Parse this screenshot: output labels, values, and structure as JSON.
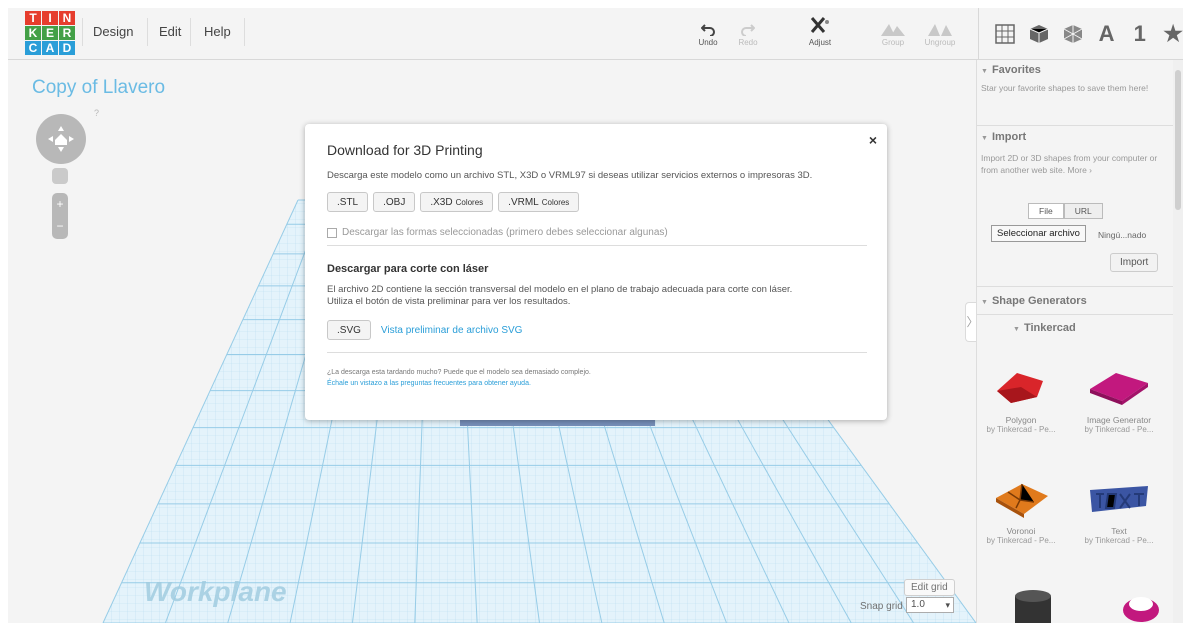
{
  "app": {
    "logo_letters": [
      "T",
      "I",
      "N",
      "K",
      "E",
      "R",
      "C",
      "A",
      "D"
    ],
    "menu": [
      "Design",
      "Edit",
      "Help"
    ],
    "toolbar": [
      {
        "label": "Undo",
        "icon": "undo-icon",
        "enabled": true
      },
      {
        "label": "Redo",
        "icon": "redo-icon",
        "enabled": false
      },
      {
        "label": "Adjust",
        "icon": "adjust-icon",
        "enabled": true
      },
      {
        "label": "Group",
        "icon": "group-icon",
        "enabled": false
      },
      {
        "label": "Ungroup",
        "icon": "ungroup-icon",
        "enabled": false
      }
    ],
    "view_tools": {
      "letter_a": "A",
      "number_1": "1",
      "star": "★"
    }
  },
  "workspace": {
    "project_title": "Copy of Llavero",
    "help_mark": "?",
    "workplane_label": "Workplane",
    "edit_grid": "Edit grid",
    "snap_grid_label": "Snap grid",
    "snap_grid_value": "1.0"
  },
  "dialog": {
    "title": "Download for 3D Printing",
    "close": "×",
    "description": "Descarga este modelo como un archivo STL, X3D o VRML97 si deseas utilizar servicios externos o impresoras 3D.",
    "formats": [
      {
        "label": ".STL",
        "sub": ""
      },
      {
        "label": ".OBJ",
        "sub": ""
      },
      {
        "label": ".X3D",
        "sub": "Colores"
      },
      {
        "label": ".VRML",
        "sub": "Colores"
      }
    ],
    "checkbox_label": "Descargar las formas seleccionadas (primero debes seleccionar algunas)",
    "laser_title": "Descargar para corte con láser",
    "laser_text_1": "El archivo 2D contiene la sección transversal del modelo en el plano de trabajo adecuada para corte con láser.",
    "laser_text_2": "Utiliza el botón de vista preliminar para ver los resultados.",
    "svg_button": ".SVG",
    "svg_preview_link": "Vista preliminar de archivo SVG",
    "note_1": "¿La descarga esta tardando mucho? Puede que el modelo sea demasiado complejo.",
    "note_2": "Échale un vistazo a las preguntas frecuentes para obtener ayuda."
  },
  "sidebar": {
    "favorites_title": "Favorites",
    "favorites_text": "Star your favorite shapes to save them here!",
    "import_title": "Import",
    "import_text": "Import 2D or 3D shapes from your computer or from another web site. More ›",
    "tab_file": "File",
    "tab_url": "URL",
    "select_file": "Seleccionar archivo",
    "file_status": "Ningú...nado",
    "import_button": "Import",
    "generators_title": "Shape Generators",
    "tinkercad_title": "Tinkercad",
    "shapes": [
      {
        "name": "Polygon",
        "by": "by Tinkercad - Pe...",
        "color": "#d9252a"
      },
      {
        "name": "Image Generator",
        "by": "by Tinkercad - Pe...",
        "color": "#c2187e"
      },
      {
        "name": "Voronoi",
        "by": "by Tinkercad - Pe...",
        "color": "#e07a1c"
      },
      {
        "name": "Text",
        "by": "by Tinkercad - Pe...",
        "color": "#3b55a3"
      }
    ]
  }
}
